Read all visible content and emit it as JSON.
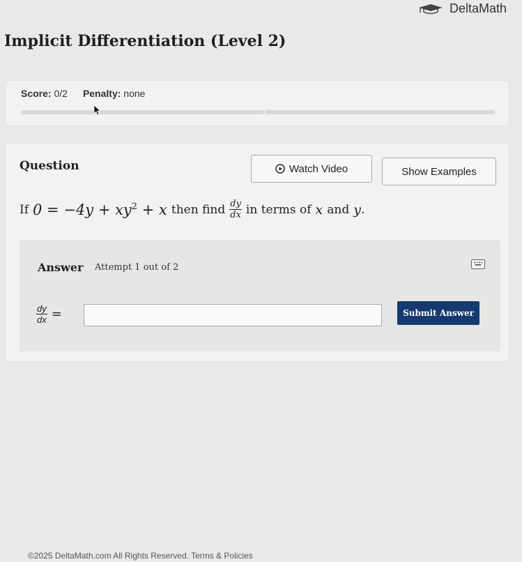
{
  "brand": {
    "name": "DeltaMath",
    "icon": "graduation-cap-icon"
  },
  "page": {
    "title": "Implicit Differentiation (Level 2)"
  },
  "score": {
    "score_label": "Score:",
    "score_value": "0/2",
    "penalty_label": "Penalty:",
    "penalty_value": "none",
    "progress_fraction": 0.0
  },
  "question": {
    "label": "Question",
    "watch_video_label": "Watch Video",
    "show_examples_label": "Show Examples",
    "prompt_prefix": "If",
    "equation_lhs": "0 = −4y + xy",
    "equation_exp": "2",
    "equation_rhs": " + x",
    "prompt_then": "then find",
    "frac_num": "dy",
    "frac_den": "dx",
    "prompt_suffix_1": "in terms of",
    "var_x": "x",
    "prompt_and": "and",
    "var_y": "y",
    "prompt_period": "."
  },
  "answer": {
    "label": "Answer",
    "attempt_text": "Attempt 1 out of 2",
    "lhs_num": "dy",
    "lhs_den": "dx",
    "equals": "=",
    "input_value": "",
    "submit_label": "Submit Answer"
  },
  "footer": {
    "text": "©2025 DeltaMath.com All Rights Reserved.",
    "terms_label": "Terms & Policies"
  },
  "colors": {
    "submit_bg": "#163a6f",
    "page_bg": "#e9e9e7"
  }
}
